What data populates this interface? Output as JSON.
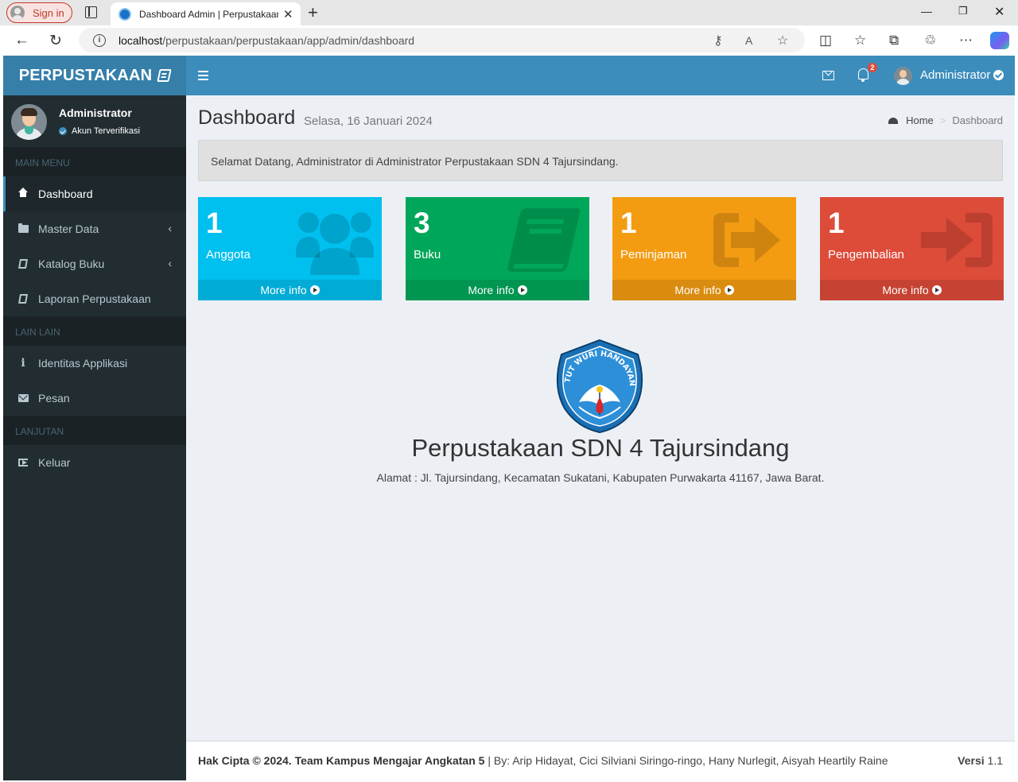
{
  "browser": {
    "signin_label": "Sign in",
    "tab_title": "Dashboard Admin | Perpustakaan",
    "url_host": "localhost",
    "url_path": "/perpustakaan/perpustakaan/app/admin/dashboard"
  },
  "sidebar": {
    "logo": "PERPUSTAKAAN",
    "user_name": "Administrator",
    "user_status": "Akun Terverifikasi",
    "sections": [
      "MAIN MENU",
      "LAIN LAIN",
      "LANJUTAN"
    ],
    "items": [
      {
        "label": "Dashboard",
        "icon": "home-icon"
      },
      {
        "label": "Master Data",
        "icon": "folder-icon"
      },
      {
        "label": "Katalog Buku",
        "icon": "book-icon"
      },
      {
        "label": "Laporan Perpustakaan",
        "icon": "book-icon"
      },
      {
        "label": "Identitas Applikasi",
        "icon": "info-icon"
      },
      {
        "label": "Pesan",
        "icon": "envelope-icon"
      },
      {
        "label": "Keluar",
        "icon": "sign-out-icon"
      }
    ]
  },
  "header": {
    "notification_count": "2",
    "user_name": "Administrator"
  },
  "content": {
    "title": "Dashboard",
    "subtitle": "Selasa, 16 Januari 2024",
    "breadcrumb": [
      "Home",
      "Dashboard"
    ],
    "welcome": "Selamat Datang, Administrator di Administrator Perpustakaan SDN 4 Tajursindang.",
    "boxes": [
      {
        "count": "1",
        "label": "Anggota",
        "more": "More info",
        "color": "#00c0ef",
        "icon": "users-icon"
      },
      {
        "count": "3",
        "label": "Buku",
        "more": "More info",
        "color": "#00a65a",
        "icon": "book-icon"
      },
      {
        "count": "1",
        "label": "Peminjaman",
        "more": "More info",
        "color": "#f39c12",
        "icon": "sign-out-icon"
      },
      {
        "count": "1",
        "label": "Pengembalian",
        "more": "More info",
        "color": "#dd4b39",
        "icon": "sign-in-icon"
      }
    ],
    "emblem_text": "TUT WURI HANDAYANI",
    "school_name": "Perpustakaan SDN 4 Tajursindang",
    "school_address": "Alamat : Jl. Tajursindang, Kecamatan Sukatani, Kabupaten Purwakarta 41167, Jawa Barat."
  },
  "footer": {
    "copyright": "Hak Cipta © 2024. Team Kampus Mengajar Angkatan 5",
    "authors": " | By: Arip Hidayat, Cici Silviani Siringo-ringo, Hany Nurlegit, Aisyah Heartily Raine",
    "version_label": "Versi",
    "version": "1.1"
  }
}
